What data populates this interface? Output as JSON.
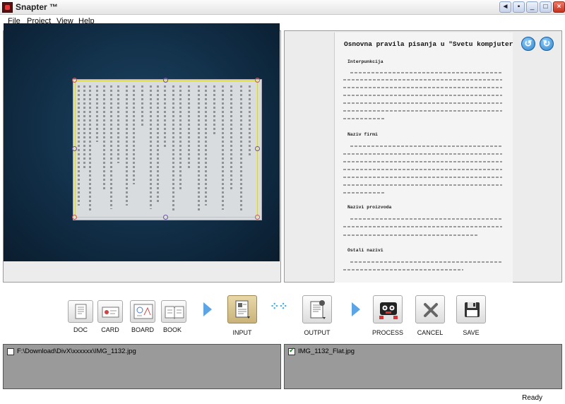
{
  "window": {
    "title": "Snapter ™",
    "controls": [
      "back",
      "fwd",
      "min",
      "max",
      "close"
    ]
  },
  "menu": [
    "File",
    "Project",
    "View",
    "Help"
  ],
  "document": {
    "title": "Osnovna pravila pisanja u \"Svetu kompjutera\"",
    "sections": [
      "Interpunkcija",
      "Naziv firmi",
      "Nazivi proizvoda",
      "Ostali nazivi"
    ]
  },
  "toolbar": {
    "doc": "DOC",
    "card": "CARD",
    "board": "BOARD",
    "book": "BOOK",
    "input": "INPUT",
    "output": "OUTPUT",
    "process": "PROCESS",
    "cancel": "CANCEL",
    "save": "SAVE"
  },
  "files": {
    "input": {
      "path": "F:\\Download\\DivX\\xxxxxx\\IMG_1132.jpg",
      "checked": false
    },
    "output": {
      "path": "IMG_1132_Flat.jpg",
      "checked": true
    }
  },
  "status": "Ready",
  "colors": {
    "accent": "#5ba4e6",
    "selected_tool": "#c9b379",
    "guide": "#d8d43a"
  }
}
